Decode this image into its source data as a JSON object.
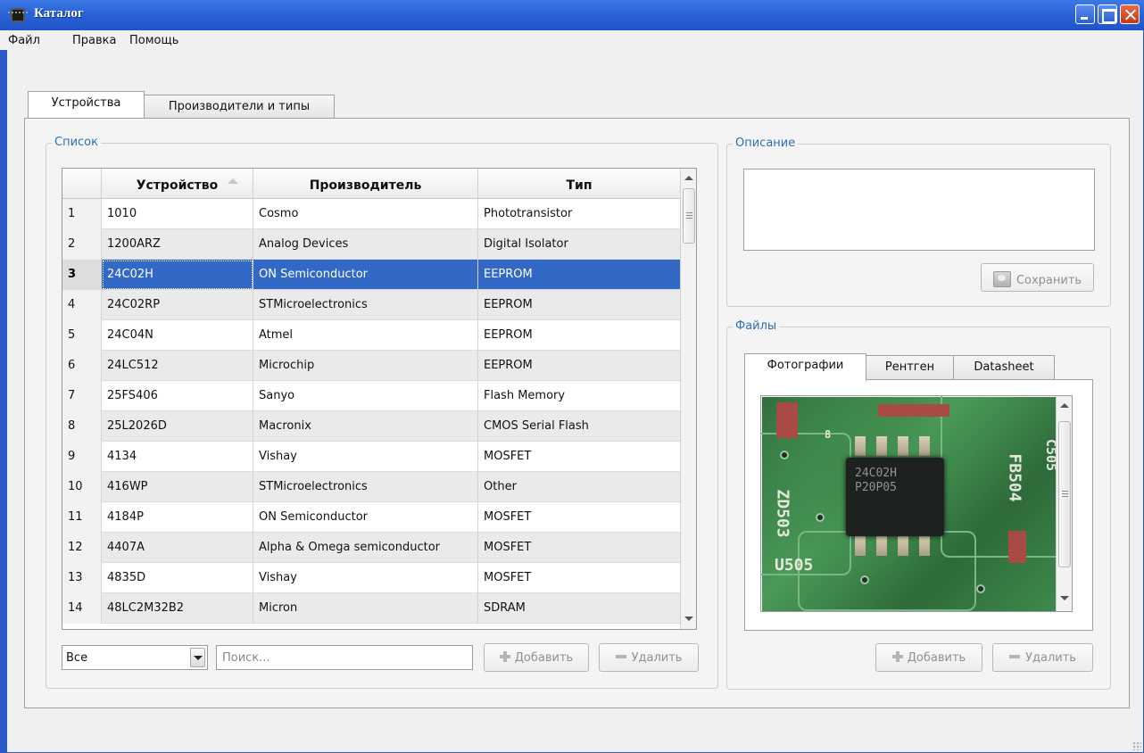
{
  "window": {
    "title": "Каталог"
  },
  "menu": [
    "Файл",
    "Правка",
    "Помощь"
  ],
  "tabs": [
    {
      "label": "Устройства",
      "active": true
    },
    {
      "label": "Производители и типы",
      "active": false
    }
  ],
  "list": {
    "title": "Список",
    "columns": [
      "Устройство",
      "Производитель",
      "Тип"
    ],
    "rows": [
      {
        "n": "1",
        "device": "1010",
        "maker": "Cosmo",
        "type": "Phototransistor"
      },
      {
        "n": "2",
        "device": "1200ARZ",
        "maker": "Analog Devices",
        "type": "Digital Isolator"
      },
      {
        "n": "3",
        "device": "24C02H",
        "maker": "ON Semiconductor",
        "type": "EEPROM",
        "selected": true
      },
      {
        "n": "4",
        "device": "24C02RP",
        "maker": "STMicroelectronics",
        "type": "EEPROM"
      },
      {
        "n": "5",
        "device": "24C04N",
        "maker": "Atmel",
        "type": "EEPROM"
      },
      {
        "n": "6",
        "device": "24LC512",
        "maker": "Microchip",
        "type": "EEPROM"
      },
      {
        "n": "7",
        "device": "25FS406",
        "maker": "Sanyo",
        "type": "Flash Memory"
      },
      {
        "n": "8",
        "device": "25L2026D",
        "maker": "Macronix",
        "type": "CMOS Serial Flash"
      },
      {
        "n": "9",
        "device": "4134",
        "maker": "Vishay",
        "type": "MOSFET"
      },
      {
        "n": "10",
        "device": "416WP",
        "maker": "STMicroelectronics",
        "type": "Other"
      },
      {
        "n": "11",
        "device": "4184P",
        "maker": "ON Semiconductor",
        "type": "MOSFET"
      },
      {
        "n": "12",
        "device": "4407A",
        "maker": "Alpha & Omega semiconductor",
        "type": "MOSFET"
      },
      {
        "n": "13",
        "device": "4835D",
        "maker": "Vishay",
        "type": "MOSFET"
      },
      {
        "n": "14",
        "device": "48LC2M32B2",
        "maker": "Micron",
        "type": "SDRAM"
      }
    ],
    "filter_value": "Все",
    "search_placeholder": "Поиск...",
    "add_label": "Добавить",
    "delete_label": "Удалить"
  },
  "description": {
    "title": "Описание",
    "save_label": "Сохранить"
  },
  "files": {
    "title": "Файлы",
    "tabs": [
      {
        "label": "Фотографии",
        "active": true
      },
      {
        "label": "Рентген",
        "active": false
      },
      {
        "label": "Datasheet",
        "active": false
      }
    ],
    "chip_marking": [
      "24C02H",
      "P20P05"
    ],
    "silkscreen": [
      "C505",
      "FB504",
      "ZD503",
      "U505",
      "8"
    ],
    "add_label": "Добавить",
    "delete_label": "Удалить"
  },
  "colors": {
    "titlebar": "#2a63d8",
    "selection": "#3268c6",
    "group_title": "#2f6eb4"
  }
}
